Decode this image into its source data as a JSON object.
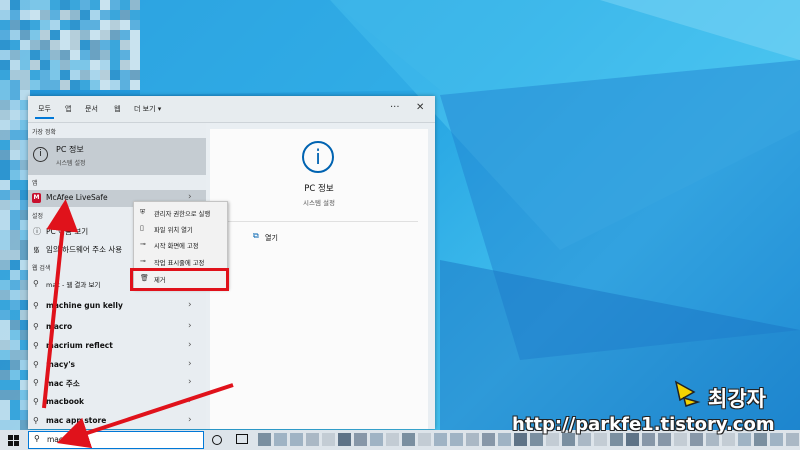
{
  "search_tabs": [
    {
      "label": "모두",
      "active": true
    },
    {
      "label": "앱"
    },
    {
      "label": "문서"
    },
    {
      "label": "웹"
    },
    {
      "label": "더 보기 ▾"
    }
  ],
  "more_label": "···",
  "close_label": "✕",
  "best_match": {
    "section": "가장 정확",
    "title": "PC 정보",
    "subtitle": "시스템 설정"
  },
  "apps": {
    "section": "앱",
    "items": [
      {
        "label": "McAfee LiveSafe",
        "icon": "mcafee-shield-icon"
      }
    ]
  },
  "settings": {
    "section": "설정",
    "items": [
      {
        "label": "PC 이름 보기"
      },
      {
        "label": "임의 하드웨어 주소 사용"
      }
    ]
  },
  "web": {
    "section": "웹 검색",
    "items": [
      {
        "label": "mac - 웹 결과 보기"
      },
      {
        "label": "machine gun kelly"
      },
      {
        "label": "macro"
      },
      {
        "label": "macrium reflect"
      },
      {
        "label": "macy's"
      },
      {
        "label": "mac 주소"
      },
      {
        "label": "macbook"
      },
      {
        "label": "mac app store"
      }
    ]
  },
  "preview": {
    "title": "PC 정보",
    "subtitle": "시스템 설정",
    "open_label": "열기"
  },
  "context_menu": [
    {
      "label": "관리자 권한으로 실행",
      "icon": "admin-icon"
    },
    {
      "label": "파일 위치 열기",
      "icon": "file-location-icon"
    },
    {
      "label": "시작 화면에 고정",
      "icon": "pin-start-icon"
    },
    {
      "label": "작업 표시줄에 고정",
      "icon": "pin-taskbar-icon"
    },
    {
      "label": "제거",
      "icon": "trash-icon"
    }
  ],
  "taskbar": {
    "search_value": "mac"
  },
  "watermark": {
    "name": "최강자",
    "url": "http://parkfe1.tistory.com"
  },
  "colors": {
    "accent": "#0078d7",
    "highlight": "#e0121b",
    "desktop": "#2aa8e4"
  }
}
